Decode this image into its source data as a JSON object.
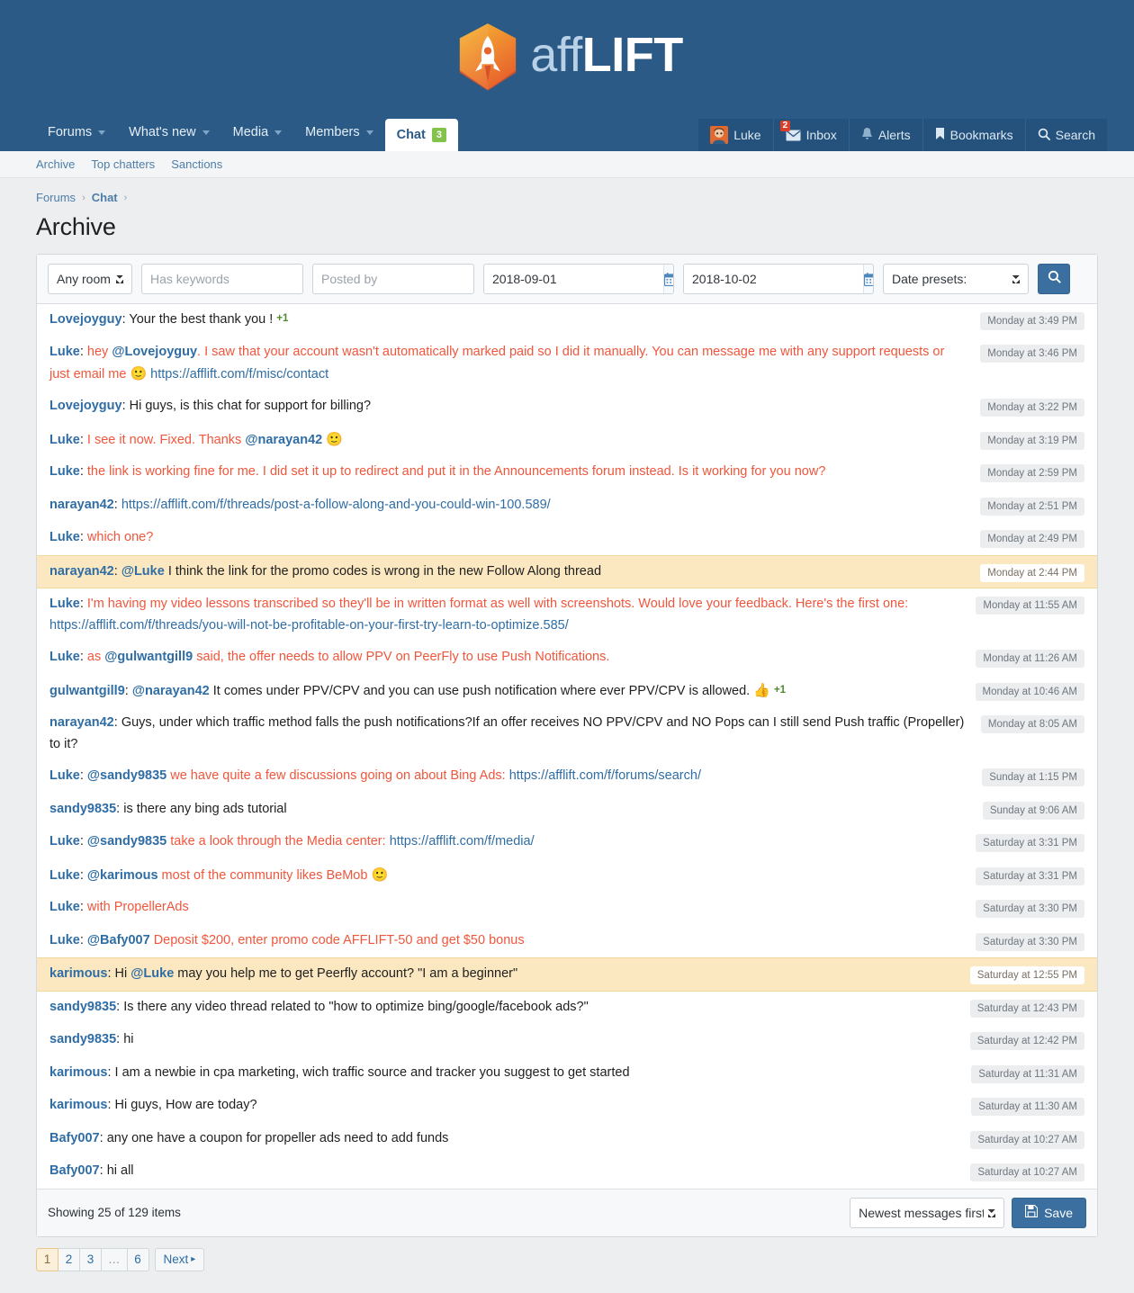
{
  "brand": {
    "logo_aff": "aff",
    "logo_lift": "LIFT",
    "primary_color": "#2b5a87",
    "accent_color": "#f0563c",
    "link_color": "#2f6da4"
  },
  "nav": {
    "left": [
      {
        "label": "Forums",
        "has_caret": true,
        "active": false
      },
      {
        "label": "What's new",
        "has_caret": true,
        "active": false
      },
      {
        "label": "Media",
        "has_caret": true,
        "active": false
      },
      {
        "label": "Members",
        "has_caret": true,
        "active": false
      },
      {
        "label": "Chat",
        "has_caret": false,
        "active": true,
        "badge": "3"
      }
    ],
    "right": [
      {
        "label": "Luke",
        "icon": "avatar"
      },
      {
        "label": "Inbox",
        "icon": "envelope-icon",
        "count": "2"
      },
      {
        "label": "Alerts",
        "icon": "bell-icon"
      },
      {
        "label": "Bookmarks",
        "icon": "bookmark-icon"
      },
      {
        "label": "Search",
        "icon": "search-icon"
      }
    ]
  },
  "subnav": [
    {
      "label": "Archive"
    },
    {
      "label": "Top chatters"
    },
    {
      "label": "Sanctions"
    }
  ],
  "breadcrumb": [
    {
      "label": "Forums",
      "strong": false
    },
    {
      "label": "Chat",
      "strong": true
    }
  ],
  "page_title": "Archive",
  "filters": {
    "room": {
      "value": "Any room",
      "options": [
        "Any room"
      ]
    },
    "keywords": {
      "value": "",
      "placeholder": "Has keywords"
    },
    "posted_by": {
      "value": "",
      "placeholder": "Posted by"
    },
    "date_from": {
      "value": "2018-09-01"
    },
    "date_to": {
      "value": "2018-10-02"
    },
    "presets": {
      "value": "Date presets:",
      "options": [
        "Date presets:"
      ]
    },
    "calendar_icon": "calendar-icon",
    "search_icon": "search-icon"
  },
  "messages": [
    {
      "user": "Lovejoyguy",
      "time": "Monday at 3:49 PM",
      "highlight": false,
      "parts": [
        {
          "t": "text",
          "v": "Your the best thank you ! ",
          "style": "black"
        },
        {
          "t": "plusone",
          "v": "+1"
        }
      ]
    },
    {
      "user": "Luke",
      "time": "Monday at 3:46 PM",
      "highlight": false,
      "parts": [
        {
          "t": "text",
          "v": "hey ",
          "style": "red"
        },
        {
          "t": "mention",
          "v": "@Lovejoyguy"
        },
        {
          "t": "text",
          "v": ". I saw that your account wasn't automatically marked paid so I did it manually. You can message me with any support requests or just email me ",
          "style": "red"
        },
        {
          "t": "emoji",
          "v": "🙂"
        },
        {
          "t": "text",
          "v": " ",
          "style": "red"
        },
        {
          "t": "link",
          "v": "https://afflift.com/f/misc/contact"
        }
      ]
    },
    {
      "user": "Lovejoyguy",
      "time": "Monday at 3:22 PM",
      "highlight": false,
      "parts": [
        {
          "t": "text",
          "v": "Hi guys, is this chat for support for billing?",
          "style": "black"
        }
      ]
    },
    {
      "user": "Luke",
      "time": "Monday at 3:19 PM",
      "highlight": false,
      "parts": [
        {
          "t": "text",
          "v": "I see it now. Fixed. Thanks ",
          "style": "red"
        },
        {
          "t": "mention",
          "v": "@narayan42"
        },
        {
          "t": "text",
          "v": " ",
          "style": "red"
        },
        {
          "t": "emoji",
          "v": "🙂"
        }
      ]
    },
    {
      "user": "Luke",
      "time": "Monday at 2:59 PM",
      "highlight": false,
      "parts": [
        {
          "t": "text",
          "v": "the link is working fine for me. I did set it up to redirect and put it in the Announcements forum instead. Is it working for you now?",
          "style": "red"
        }
      ]
    },
    {
      "user": "narayan42",
      "time": "Monday at 2:51 PM",
      "highlight": false,
      "parts": [
        {
          "t": "link",
          "v": "https://afflift.com/f/threads/post-a-follow-along-and-you-could-win-100.589/"
        }
      ]
    },
    {
      "user": "Luke",
      "time": "Monday at 2:49 PM",
      "highlight": false,
      "parts": [
        {
          "t": "text",
          "v": "which one?",
          "style": "red"
        }
      ]
    },
    {
      "user": "narayan42",
      "time": "Monday at 2:44 PM",
      "highlight": true,
      "parts": [
        {
          "t": "mention",
          "v": "@Luke"
        },
        {
          "t": "text",
          "v": " I think the link for the promo codes is wrong in the new Follow Along thread",
          "style": "black"
        }
      ]
    },
    {
      "user": "Luke",
      "time": "Monday at 11:55 AM",
      "highlight": false,
      "parts": [
        {
          "t": "text",
          "v": "I'm having my video lessons transcribed so they'll be in written format as well with screenshots. Would love your feedback. Here's the first one: ",
          "style": "red"
        },
        {
          "t": "link",
          "v": "https://afflift.com/f/threads/you-will-not-be-profitable-on-your-first-try-learn-to-optimize.585/"
        }
      ]
    },
    {
      "user": "Luke",
      "time": "Monday at 11:26 AM",
      "highlight": false,
      "parts": [
        {
          "t": "text",
          "v": "as ",
          "style": "red"
        },
        {
          "t": "mention",
          "v": "@gulwantgill9"
        },
        {
          "t": "text",
          "v": " said, the offer needs to allow PPV on PeerFly to use Push Notifications.",
          "style": "red"
        }
      ]
    },
    {
      "user": "gulwantgill9",
      "time": "Monday at 10:46 AM",
      "highlight": false,
      "parts": [
        {
          "t": "mention",
          "v": "@narayan42"
        },
        {
          "t": "text",
          "v": " It comes under PPV/CPV and you can use push notification where ever PPV/CPV is allowed. ",
          "style": "black"
        },
        {
          "t": "emoji",
          "v": "👍"
        },
        {
          "t": "text",
          "v": " ",
          "style": "black"
        },
        {
          "t": "plusone",
          "v": "+1"
        }
      ]
    },
    {
      "user": "narayan42",
      "time": "Monday at 8:05 AM",
      "highlight": false,
      "parts": [
        {
          "t": "text",
          "v": "Guys, under which traffic method falls the push notifications?If an offer receives NO PPV/CPV and NO Pops can I still send Push traffic (Propeller) to it?",
          "style": "black"
        }
      ]
    },
    {
      "user": "Luke",
      "time": "Sunday at 1:15 PM",
      "highlight": false,
      "parts": [
        {
          "t": "mention",
          "v": "@sandy9835"
        },
        {
          "t": "text",
          "v": " we have quite a few discussions going on about Bing Ads: ",
          "style": "red"
        },
        {
          "t": "link",
          "v": "https://afflift.com/f/forums/search/"
        }
      ]
    },
    {
      "user": "sandy9835",
      "time": "Sunday at 9:06 AM",
      "highlight": false,
      "parts": [
        {
          "t": "text",
          "v": "is there any bing ads tutorial",
          "style": "black"
        }
      ]
    },
    {
      "user": "Luke",
      "time": "Saturday at 3:31 PM",
      "highlight": false,
      "parts": [
        {
          "t": "mention",
          "v": "@sandy9835"
        },
        {
          "t": "text",
          "v": " take a look through the Media center: ",
          "style": "red"
        },
        {
          "t": "link",
          "v": "https://afflift.com/f/media/"
        }
      ]
    },
    {
      "user": "Luke",
      "time": "Saturday at 3:31 PM",
      "highlight": false,
      "parts": [
        {
          "t": "mention",
          "v": "@karimous"
        },
        {
          "t": "text",
          "v": " most of the community likes BeMob ",
          "style": "red"
        },
        {
          "t": "emoji",
          "v": "🙂"
        }
      ]
    },
    {
      "user": "Luke",
      "time": "Saturday at 3:30 PM",
      "highlight": false,
      "parts": [
        {
          "t": "text",
          "v": "with PropellerAds",
          "style": "red"
        }
      ]
    },
    {
      "user": "Luke",
      "time": "Saturday at 3:30 PM",
      "highlight": false,
      "parts": [
        {
          "t": "mention",
          "v": "@Bafy007"
        },
        {
          "t": "text",
          "v": " Deposit $200, enter promo code AFFLIFT-50 and get $50 bonus",
          "style": "red"
        }
      ]
    },
    {
      "user": "karimous",
      "time": "Saturday at 12:55 PM",
      "highlight": true,
      "parts": [
        {
          "t": "text",
          "v": "Hi ",
          "style": "black"
        },
        {
          "t": "mention",
          "v": "@Luke"
        },
        {
          "t": "text",
          "v": " may you help me to get Peerfly account? \"I am a beginner\"",
          "style": "black"
        }
      ]
    },
    {
      "user": "sandy9835",
      "time": "Saturday at 12:43 PM",
      "highlight": false,
      "parts": [
        {
          "t": "text",
          "v": "Is there any video thread related to \"how to optimize bing/google/facebook ads?\"",
          "style": "black"
        }
      ]
    },
    {
      "user": "sandy9835",
      "time": "Saturday at 12:42 PM",
      "highlight": false,
      "parts": [
        {
          "t": "text",
          "v": "hi",
          "style": "black"
        }
      ]
    },
    {
      "user": "karimous",
      "time": "Saturday at 11:31 AM",
      "highlight": false,
      "parts": [
        {
          "t": "text",
          "v": "I am a newbie in cpa marketing, wich traffic source and tracker you suggest to get started",
          "style": "black"
        }
      ]
    },
    {
      "user": "karimous",
      "time": "Saturday at 11:30 AM",
      "highlight": false,
      "parts": [
        {
          "t": "text",
          "v": "Hi guys, How are today?",
          "style": "black"
        }
      ]
    },
    {
      "user": "Bafy007",
      "time": "Saturday at 10:27 AM",
      "highlight": false,
      "parts": [
        {
          "t": "text",
          "v": "any one have a coupon for propeller ads need to add funds",
          "style": "black"
        }
      ]
    },
    {
      "user": "Bafy007",
      "time": "Saturday at 10:27 AM",
      "highlight": false,
      "parts": [
        {
          "t": "text",
          "v": "hi all",
          "style": "black"
        }
      ]
    }
  ],
  "footer": {
    "showing": "Showing 25 of 129 items",
    "sort": {
      "value": "Newest messages first",
      "options": [
        "Newest messages first"
      ]
    },
    "save_label": "Save",
    "save_icon": "floppy-disk-icon"
  },
  "pagination": {
    "pages": [
      "1",
      "2",
      "3",
      "…",
      "6"
    ],
    "current": "1",
    "next_label": "Next"
  }
}
